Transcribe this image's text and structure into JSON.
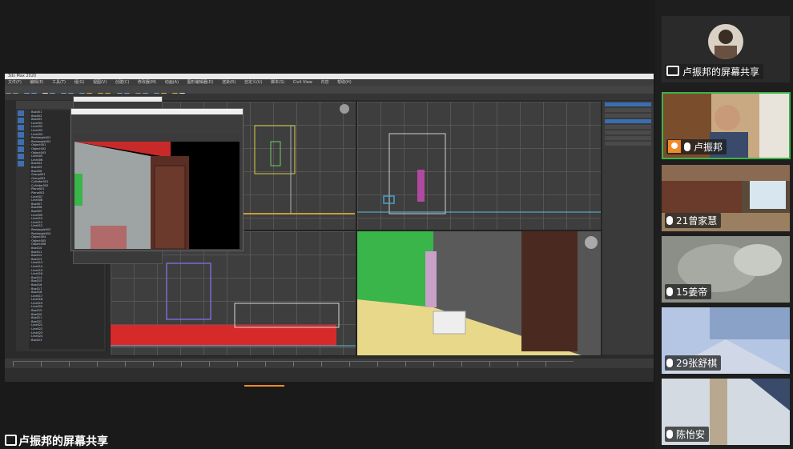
{
  "app": {
    "title": "3ds Max 2020",
    "menu": [
      "文件(F)",
      "编辑(E)",
      "工具(T)",
      "组(G)",
      "视图(V)",
      "创建(C)",
      "修改器(M)",
      "动画(A)",
      "图形编辑器(D)",
      "渲染(R)",
      "自定义(U)",
      "脚本(S)",
      "Civil View",
      "内容",
      "帮助(H)"
    ]
  },
  "scene_explorer": {
    "items": [
      "Box001",
      "Box002",
      "Box003",
      "Line001",
      "Line002",
      "Line003",
      "Line004",
      "Rectangle001",
      "Rectangle002",
      "Object001",
      "Object002",
      "Object003",
      "Line005",
      "Line006",
      "Box004",
      "Box005",
      "Box006",
      "Group001",
      "Group002",
      "Cylinder001",
      "Cylinder002",
      "Plane001",
      "Plane002",
      "Line007",
      "Line008",
      "Box007",
      "Box008",
      "Box009",
      "Line009",
      "Line010",
      "Line011",
      "Line012",
      "Rectangle003",
      "Rectangle004",
      "Object004",
      "Object005",
      "Object006",
      "Box010",
      "Box011",
      "Box012",
      "Box013",
      "Line013",
      "Line014",
      "Line015",
      "Line016",
      "Box014",
      "Box015",
      "Box016",
      "Box017",
      "Box018",
      "Line017",
      "Line018",
      "Line019",
      "Line020",
      "Box019",
      "Box020",
      "Box021",
      "Box022",
      "Line021",
      "Line022",
      "Line023",
      "Line024",
      "Box023"
    ]
  },
  "colors": {
    "accent_green": "#3fb24a",
    "share_orange": "#f08a2a",
    "red_floor": "#d62a2a",
    "green_wall": "#39b54a",
    "floor_yellow": "#e8d88a"
  },
  "share_caption": "卢振邦的屏幕共享",
  "participants": [
    {
      "name": "卢振邦的屏幕共享",
      "icon": "screen-share-icon"
    },
    {
      "name": "卢振邦",
      "icon": "user-icon"
    },
    {
      "name": "21曾家慧",
      "icon": "mic-icon"
    },
    {
      "name": "15姜帝",
      "icon": "mic-icon"
    },
    {
      "name": "29张舒棋",
      "icon": "mic-icon"
    },
    {
      "name": "陈怡安",
      "icon": "mic-icon"
    }
  ]
}
